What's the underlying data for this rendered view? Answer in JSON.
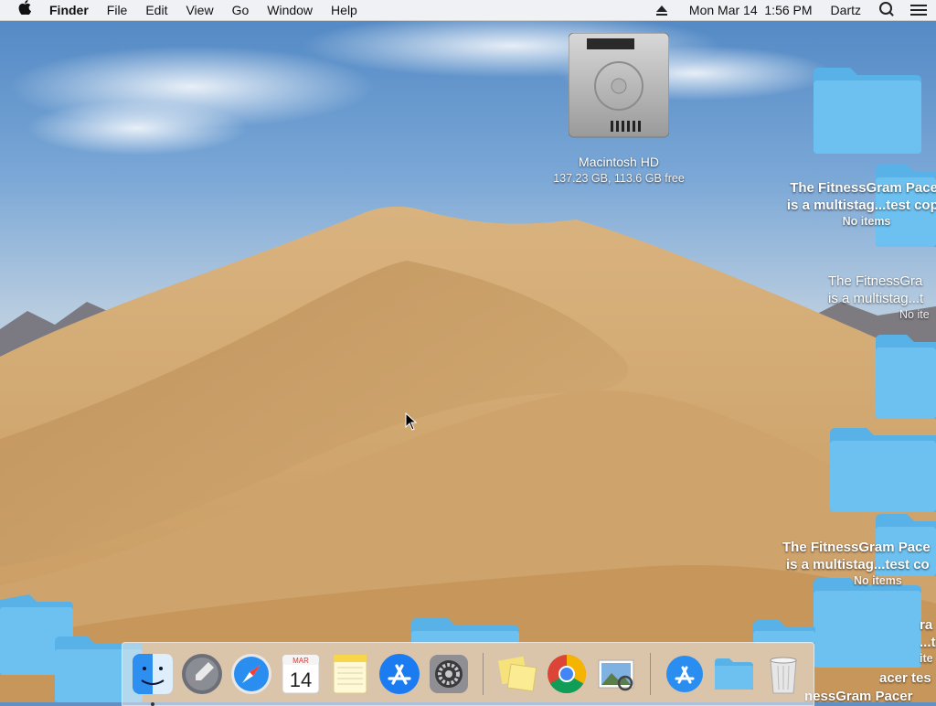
{
  "menubar": {
    "apple_icon": "apple-icon",
    "app_name": "Finder",
    "menus": [
      "File",
      "Edit",
      "View",
      "Go",
      "Window",
      "Help"
    ],
    "datetime": "Mon Mar 14  1:56 PM",
    "user": "Dartz"
  },
  "desktop": {
    "drive": {
      "name": "Macintosh HD",
      "info": "137.23 GB, 113.6 GB free"
    },
    "folder1": {
      "name_line1": "The FitnessGram Pacer",
      "name_line2": "is a multistag...test copy",
      "info": "No items"
    },
    "folder2": {
      "name_line1": "The FitnessGra",
      "name_line2": "is a multistag...t",
      "info": "No ite"
    },
    "folder3": {
      "name_line1": "The FitnessGram Pace",
      "name_line2": "is a multistag...test co",
      "info": "No items"
    },
    "folder4": {
      "name_line1": "ra",
      "name_line2": "...t",
      "info": "ite"
    },
    "folder5": {
      "name_line1": "acer tes",
      "name_line2": "nessGram Pacer"
    }
  },
  "dock": {
    "apps": [
      "finder",
      "launchpad",
      "safari",
      "calendar",
      "notes",
      "app-store",
      "system-preferences",
      "stickies",
      "chrome",
      "preview",
      "downloads-app-store",
      "folder",
      "trash"
    ],
    "calendar_month": "MAR",
    "calendar_day": "14"
  },
  "colors": {
    "folder_blue": "#6cc1f0",
    "folder_tab": "#58b2e8",
    "accent": "#1a7cf0"
  }
}
